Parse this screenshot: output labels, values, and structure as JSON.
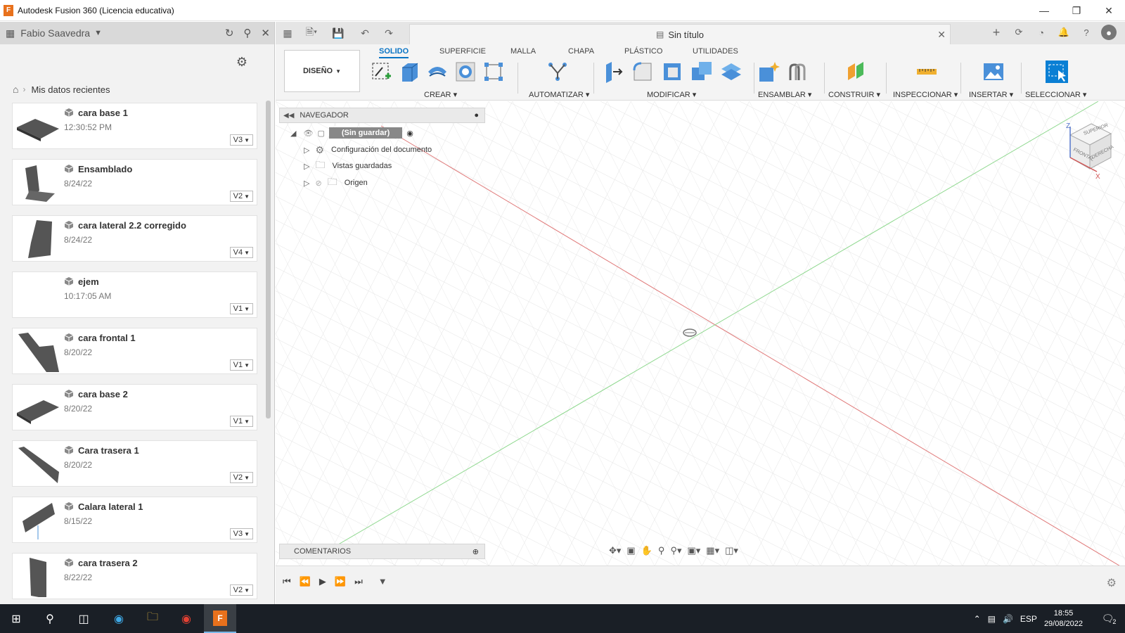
{
  "window": {
    "title": "Autodesk Fusion 360 (Licencia educativa)",
    "app_icon_glyph": "F",
    "controls": [
      "minimize-icon",
      "restore-icon",
      "close-icon"
    ]
  },
  "data_panel": {
    "user_name": "Fabio Saavedra",
    "breadcrumb": "Mis datos recientes",
    "items": [
      {
        "name": "cara base 1",
        "date": "12:30:52 PM",
        "version": "V3"
      },
      {
        "name": "Ensamblado",
        "date": "8/24/22",
        "version": "V2"
      },
      {
        "name": "cara lateral 2.2 corregido",
        "date": "8/24/22",
        "version": "V4"
      },
      {
        "name": "ejem",
        "date": "10:17:05 AM",
        "version": "V1"
      },
      {
        "name": "cara frontal 1",
        "date": "8/20/22",
        "version": "V1"
      },
      {
        "name": "cara base 2",
        "date": "8/20/22",
        "version": "V1"
      },
      {
        "name": "Cara trasera 1",
        "date": "8/20/22",
        "version": "V2"
      },
      {
        "name": "Calara lateral 1",
        "date": "8/15/22",
        "version": "V3"
      },
      {
        "name": "cara trasera 2",
        "date": "8/22/22",
        "version": "V2"
      }
    ]
  },
  "document": {
    "tab_title": "Sin título"
  },
  "ribbon": {
    "workspace": "DISEÑO",
    "tabs": [
      "SOLIDO",
      "SUPERFICIE",
      "MALLA",
      "CHAPA",
      "PLÁSTICO",
      "UTILIDADES"
    ],
    "active_tab": "SOLIDO",
    "groups": [
      "CREAR",
      "AUTOMATIZAR",
      "MODIFICAR",
      "ENSAMBLAR",
      "CONSTRUIR",
      "INSPECCIONAR",
      "INSERTAR",
      "SELECCIONAR"
    ]
  },
  "browser": {
    "title": "NAVEGADOR",
    "root": "(Sin guardar)",
    "nodes": [
      "Configuración del documento",
      "Vistas guardadas",
      "Origen"
    ]
  },
  "viewcube": {
    "faces": [
      "SUPERIOR",
      "FRONTAL",
      "DERECHA"
    ],
    "axes": [
      "Z",
      "X"
    ]
  },
  "comments": {
    "title": "COMENTARIOS"
  },
  "taskbar": {
    "language": "ESP",
    "time": "18:55",
    "date": "29/08/2022",
    "notifications": "2"
  },
  "colors": {
    "accent": "#0a74c4",
    "x_axis": "#e07a7a",
    "y_axis": "#8fd88f",
    "taskbar": "#1a1f26"
  }
}
